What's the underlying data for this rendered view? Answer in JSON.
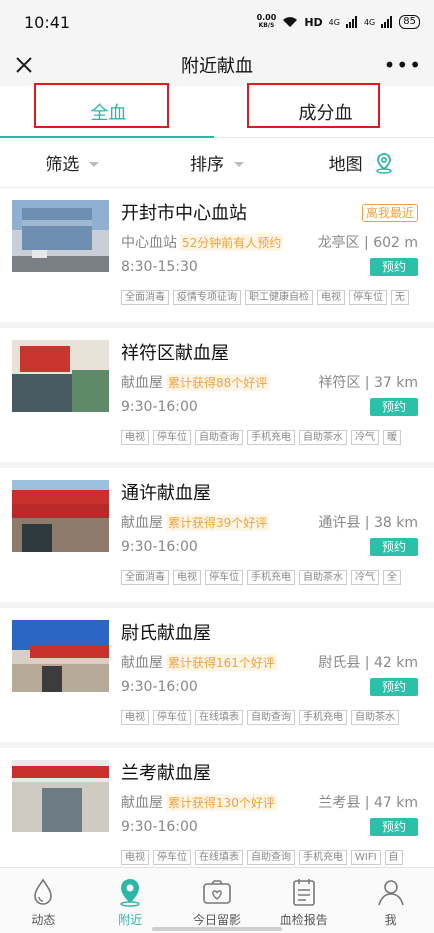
{
  "status": {
    "time": "10:41",
    "speed": "0.00",
    "speed_unit": "KB/S",
    "hd": "HD",
    "sig1": "4G",
    "sig2": "4G",
    "battery": "85"
  },
  "nav": {
    "title": "附近献血",
    "more": "•••"
  },
  "tabs": [
    {
      "label": "全血"
    },
    {
      "label": "成分血"
    }
  ],
  "filters": [
    {
      "label": "筛选"
    },
    {
      "label": "排序"
    },
    {
      "label": "地图"
    }
  ],
  "stations": [
    {
      "name": "开封市中心血站",
      "type": "中心血站",
      "hint": "52分钟前有人预约",
      "district": "龙亭区",
      "distance": "602 m",
      "hours": "8:30-15:30",
      "badge": "离我最近",
      "book": "预约",
      "tags": [
        "全面消毒",
        "疫情专项征询",
        "职工健康自检",
        "电视",
        "停车位",
        "无"
      ]
    },
    {
      "name": "祥符区献血屋",
      "type": "献血屋",
      "hint": "累计获得88个好评",
      "district": "祥符区",
      "distance": "37 km",
      "hours": "9:30-16:00",
      "book": "预约",
      "tags": [
        "电视",
        "停车位",
        "自助查询",
        "手机充电",
        "自助茶水",
        "冷气",
        "暖"
      ]
    },
    {
      "name": "通许献血屋",
      "type": "献血屋",
      "hint": "累计获得39个好评",
      "district": "通许县",
      "distance": "38 km",
      "hours": "9:30-16:00",
      "book": "预约",
      "tags": [
        "全面消毒",
        "电视",
        "停车位",
        "手机充电",
        "自助茶水",
        "冷气",
        "全"
      ]
    },
    {
      "name": "尉氏献血屋",
      "type": "献血屋",
      "hint": "累计获得161个好评",
      "district": "尉氏县",
      "distance": "42 km",
      "hours": "9:30-16:00",
      "book": "预约",
      "tags": [
        "电视",
        "停车位",
        "在线填表",
        "自助查询",
        "手机充电",
        "自助茶水"
      ]
    },
    {
      "name": "兰考献血屋",
      "type": "献血屋",
      "hint": "累计获得130个好评",
      "district": "兰考县",
      "distance": "47 km",
      "hours": "9:30-16:00",
      "book": "预约",
      "tags": [
        "电视",
        "停车位",
        "在线填表",
        "自助查询",
        "手机充电",
        "WIFI",
        "自"
      ]
    }
  ],
  "tabbar": [
    {
      "label": "动态",
      "icon": "blood-drop-icon"
    },
    {
      "label": "附近",
      "icon": "location-pin-icon"
    },
    {
      "label": "今日留影",
      "icon": "camera-heart-icon"
    },
    {
      "label": "血检报告",
      "icon": "report-calendar-icon"
    },
    {
      "label": "我",
      "icon": "person-icon"
    }
  ],
  "colors": {
    "accent": "#2bb7a8",
    "highlight_box": "#e0191e",
    "hint": "#f1a23a"
  }
}
